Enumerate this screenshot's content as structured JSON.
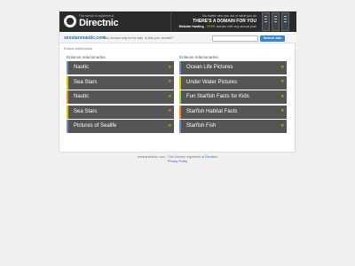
{
  "banner": {
    "small_text": "This domain is registered at",
    "brand": "Directnic",
    "tagline_1": "No matter who you are or what you do",
    "tagline_2": "THERE'S A DOMAIN FOR YOU",
    "tagline_3_bold": "Website Hosting",
    "tagline_3_free": "FREE",
    "tagline_3_rest": "domain with any annual plan"
  },
  "domain_bar": {
    "domain": "sexstarsnautic.com",
    "message": "This domain may be for sale. Is this your domain?",
    "search_placeholder": "",
    "search_button": "Search Ads"
  },
  "breadcrumb": "Enlaces relacionados",
  "left_column": {
    "title": "Enlaces relacionados",
    "items": [
      {
        "label": "Nautic",
        "accent": "#6c8ebf"
      },
      {
        "label": "Sea Stars",
        "accent": "#d9c800"
      },
      {
        "label": "Nautic",
        "accent": "#f08a24"
      },
      {
        "label": "Sea Stars",
        "accent": "#d9c800"
      },
      {
        "label": "Pictures of Sealife",
        "accent": "#6c8ebf"
      }
    ]
  },
  "right_column": {
    "title": "Enlaces relacionados",
    "items": [
      {
        "label": "Ocean Life Pictures",
        "accent": "#6c8ebf"
      },
      {
        "label": "Under Water Pictures",
        "accent": "#d9c800"
      },
      {
        "label": "Fun Starfish Facts for Kids",
        "accent": "#9dd14a"
      },
      {
        "label": "Starfish Habitat Facts",
        "accent": "#f08a24"
      },
      {
        "label": "Starfish Fish",
        "accent": "#6c8ebf"
      }
    ]
  },
  "footer": {
    "line1_prefix": "sexstarsnautic.com - This Domain registered at",
    "line1_link": "Directnic",
    "line2_link": "Privacy Policy"
  }
}
